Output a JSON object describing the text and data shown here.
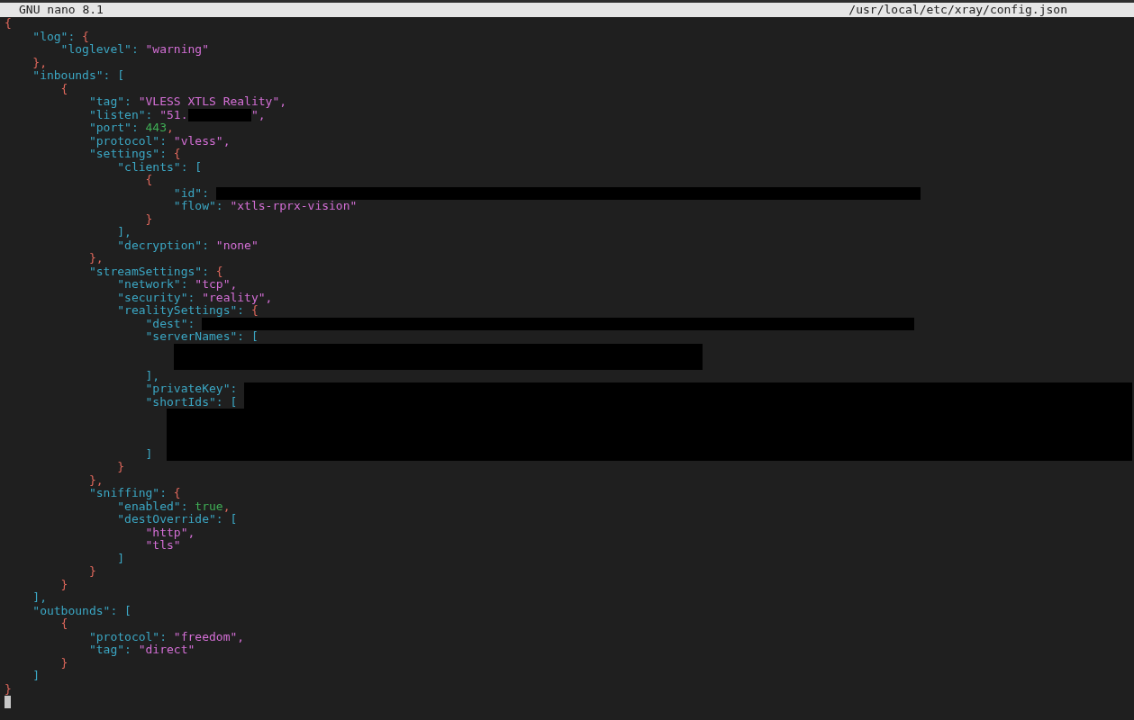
{
  "title_bar": {
    "app": "GNU nano 8.1",
    "file": "/usr/local/etc/xray/config.json"
  },
  "lines": [
    {
      "tokens": [
        {
          "kind": "brace",
          "text": "{"
        }
      ]
    },
    {
      "tokens": [
        {
          "kind": "key",
          "text": "    \"log\":"
        },
        {
          "kind": "brace",
          "text": " {"
        }
      ]
    },
    {
      "tokens": [
        {
          "kind": "key",
          "text": "        \"loglevel\":"
        },
        {
          "kind": "string",
          "text": " \"warning\""
        }
      ]
    },
    {
      "tokens": [
        {
          "kind": "brace",
          "text": "    },"
        }
      ]
    },
    {
      "tokens": [
        {
          "kind": "key",
          "text": "    \"inbounds\":"
        },
        {
          "kind": "bracket",
          "text": " ["
        }
      ]
    },
    {
      "tokens": [
        {
          "kind": "brace",
          "text": "        {"
        }
      ]
    },
    {
      "tokens": [
        {
          "kind": "key",
          "text": "            \"tag\":"
        },
        {
          "kind": "string",
          "text": " \"VLESS XTLS Reality\","
        }
      ]
    },
    {
      "tokens": [
        {
          "kind": "key",
          "text": "            \"listen\":"
        },
        {
          "kind": "string",
          "text": " \"51."
        },
        {
          "kind": "redacted"
        },
        {
          "kind": "string",
          "text": "\","
        }
      ]
    },
    {
      "tokens": [
        {
          "kind": "key",
          "text": "            \"port\":"
        },
        {
          "kind": "number",
          "text": " 443"
        },
        {
          "kind": "brace",
          "text": ","
        }
      ]
    },
    {
      "tokens": [
        {
          "kind": "key",
          "text": "            \"protocol\":"
        },
        {
          "kind": "string",
          "text": " \"vless\","
        }
      ]
    },
    {
      "tokens": [
        {
          "kind": "key",
          "text": "            \"settings\":"
        },
        {
          "kind": "brace",
          "text": " {"
        }
      ]
    },
    {
      "tokens": [
        {
          "kind": "key",
          "text": "                \"clients\":"
        },
        {
          "kind": "bracket",
          "text": " ["
        }
      ]
    },
    {
      "tokens": [
        {
          "kind": "brace",
          "text": "                    {"
        }
      ]
    },
    {
      "tokens": [
        {
          "kind": "key",
          "text": "                        \"id\":"
        },
        {
          "kind": "redacted"
        }
      ]
    },
    {
      "tokens": [
        {
          "kind": "key",
          "text": "                        \"flow\":"
        },
        {
          "kind": "string",
          "text": " \"xtls-rprx-vision\""
        }
      ]
    },
    {
      "tokens": [
        {
          "kind": "brace",
          "text": "                    }"
        }
      ]
    },
    {
      "tokens": [
        {
          "kind": "bracket",
          "text": "                ],"
        }
      ]
    },
    {
      "tokens": [
        {
          "kind": "key",
          "text": "                \"decryption\":"
        },
        {
          "kind": "string",
          "text": " \"none\""
        }
      ]
    },
    {
      "tokens": [
        {
          "kind": "brace",
          "text": "            },"
        }
      ]
    },
    {
      "tokens": [
        {
          "kind": "key",
          "text": "            \"streamSettings\":"
        },
        {
          "kind": "brace",
          "text": " {"
        }
      ]
    },
    {
      "tokens": [
        {
          "kind": "key",
          "text": "                \"network\":"
        },
        {
          "kind": "string",
          "text": " \"tcp\","
        }
      ]
    },
    {
      "tokens": [
        {
          "kind": "key",
          "text": "                \"security\":"
        },
        {
          "kind": "string",
          "text": " \"reality\","
        }
      ]
    },
    {
      "tokens": [
        {
          "kind": "key",
          "text": "                \"realitySettings\":"
        },
        {
          "kind": "brace",
          "text": " {"
        }
      ]
    },
    {
      "tokens": [
        {
          "kind": "key",
          "text": "                    \"dest\":"
        },
        {
          "kind": "redacted"
        }
      ]
    },
    {
      "tokens": [
        {
          "kind": "key",
          "text": "                    \"serverNames\":"
        },
        {
          "kind": "bracket",
          "text": " ["
        }
      ]
    },
    {
      "tokens": [
        {
          "kind": "redacted"
        }
      ]
    },
    {
      "tokens": [
        {
          "kind": "redacted"
        }
      ]
    },
    {
      "tokens": [
        {
          "kind": "bracket",
          "text": "                    ],"
        }
      ]
    },
    {
      "tokens": [
        {
          "kind": "key",
          "text": "                    \"privateKey\":"
        },
        {
          "kind": "redacted"
        }
      ]
    },
    {
      "tokens": [
        {
          "kind": "key",
          "text": "                    \"shortIds\":"
        },
        {
          "kind": "bracket",
          "text": " ["
        },
        {
          "kind": "redacted"
        }
      ]
    },
    {
      "tokens": [
        {
          "kind": "redacted"
        }
      ]
    },
    {
      "tokens": [
        {
          "kind": "redacted"
        }
      ]
    },
    {
      "tokens": [
        {
          "kind": "redacted"
        }
      ]
    },
    {
      "tokens": [
        {
          "kind": "bracket",
          "text": "                    ]"
        },
        {
          "kind": "redacted"
        }
      ]
    },
    {
      "tokens": [
        {
          "kind": "brace",
          "text": "                }"
        }
      ]
    },
    {
      "tokens": [
        {
          "kind": "brace",
          "text": "            },"
        }
      ]
    },
    {
      "tokens": [
        {
          "kind": "key",
          "text": "            \"sniffing\":"
        },
        {
          "kind": "brace",
          "text": " {"
        }
      ]
    },
    {
      "tokens": [
        {
          "kind": "key",
          "text": "                \"enabled\":"
        },
        {
          "kind": "number",
          "text": " true"
        },
        {
          "kind": "brace",
          "text": ","
        }
      ]
    },
    {
      "tokens": [
        {
          "kind": "key",
          "text": "                \"destOverride\":"
        },
        {
          "kind": "bracket",
          "text": " ["
        }
      ]
    },
    {
      "tokens": [
        {
          "kind": "string",
          "text": "                    \"http\","
        }
      ]
    },
    {
      "tokens": [
        {
          "kind": "string",
          "text": "                    \"tls\""
        }
      ]
    },
    {
      "tokens": [
        {
          "kind": "bracket",
          "text": "                ]"
        }
      ]
    },
    {
      "tokens": [
        {
          "kind": "brace",
          "text": "            }"
        }
      ]
    },
    {
      "tokens": [
        {
          "kind": "brace",
          "text": "        }"
        }
      ]
    },
    {
      "tokens": [
        {
          "kind": "bracket",
          "text": "    ],"
        }
      ]
    },
    {
      "tokens": [
        {
          "kind": "key",
          "text": "    \"outbounds\":"
        },
        {
          "kind": "bracket",
          "text": " ["
        }
      ]
    },
    {
      "tokens": [
        {
          "kind": "brace",
          "text": "        {"
        }
      ]
    },
    {
      "tokens": [
        {
          "kind": "key",
          "text": "            \"protocol\":"
        },
        {
          "kind": "string",
          "text": " \"freedom\","
        }
      ]
    },
    {
      "tokens": [
        {
          "kind": "key",
          "text": "            \"tag\":"
        },
        {
          "kind": "string",
          "text": " \"direct\""
        }
      ]
    },
    {
      "tokens": [
        {
          "kind": "brace",
          "text": "        }"
        }
      ]
    },
    {
      "tokens": [
        {
          "kind": "bracket",
          "text": "    ]"
        }
      ]
    },
    {
      "tokens": [
        {
          "kind": "brace",
          "text": "}"
        }
      ]
    }
  ]
}
